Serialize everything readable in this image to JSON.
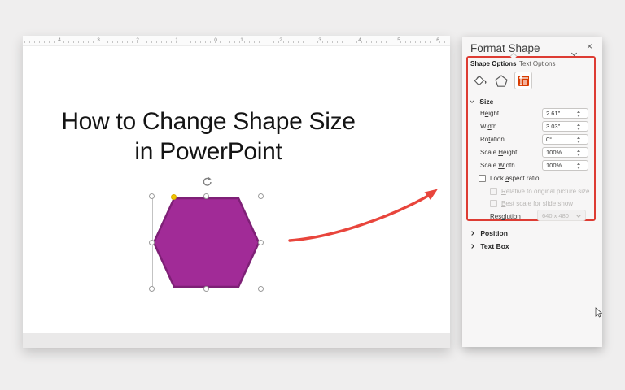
{
  "editor": {
    "ruler_numbers": [
      "4",
      "3",
      "2",
      "1",
      "0",
      "1",
      "2",
      "3",
      "4",
      "5",
      "6"
    ],
    "slide_title_line1": "How to Change Shape Size",
    "slide_title_line2": "in PowerPoint",
    "shape": {
      "fill": "#A12B97",
      "stroke": "#7E2076"
    }
  },
  "annotation": {
    "arrow_color": "#E8453C",
    "box_color": "#DD3C33"
  },
  "panel": {
    "title": "Format Shape",
    "close_glyph": "×",
    "tabs": {
      "shape_options": "Shape Options",
      "text_options": "Text Options"
    },
    "icons": [
      "fill-line-icon",
      "effects-icon",
      "size-properties-icon"
    ],
    "size": {
      "header": "Size",
      "rows": [
        {
          "pre": "H",
          "key": "e",
          "post": "ight",
          "value": "2.61\""
        },
        {
          "pre": "Wi",
          "key": "d",
          "post": "th",
          "value": "3.03\""
        },
        {
          "pre": "Ro",
          "key": "t",
          "post": "ation",
          "value": "0°"
        },
        {
          "pre": "Scale ",
          "key": "H",
          "post": "eight",
          "value": "100%"
        },
        {
          "pre": "Scale ",
          "key": "W",
          "post": "idth",
          "value": "100%"
        }
      ],
      "checkboxes": [
        {
          "pre": "Lock ",
          "key": "a",
          "post": "spect ratio"
        },
        {
          "pre": "",
          "key": "R",
          "post": "elative to original picture size"
        },
        {
          "pre": "",
          "key": "B",
          "post": "est scale for slide show"
        }
      ],
      "resolution": {
        "pre": "Res",
        "key": "o",
        "post": "lution",
        "value": "640 x 480"
      }
    },
    "sections": [
      {
        "label": "Position"
      },
      {
        "label": "Text Box"
      }
    ]
  }
}
